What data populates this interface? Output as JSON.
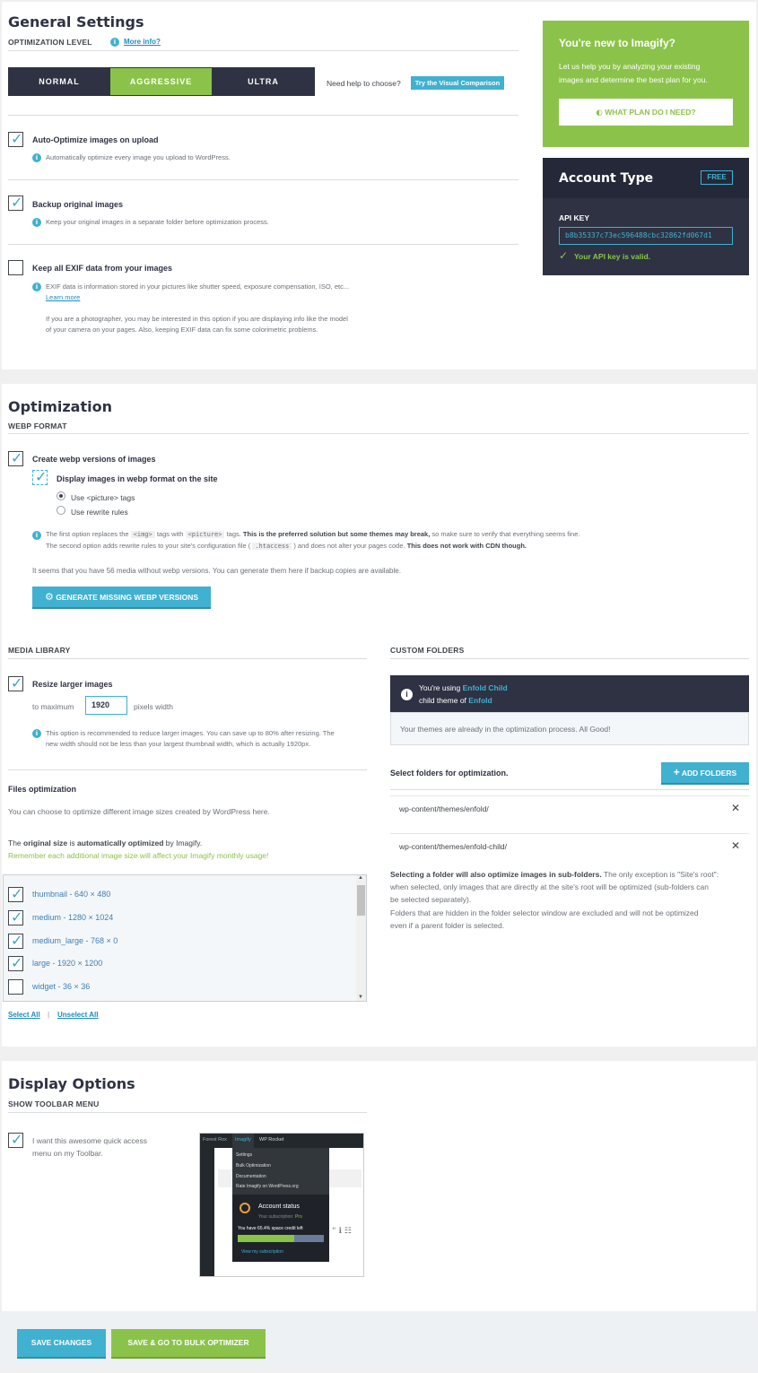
{
  "general": {
    "title": "General Settings",
    "opt_level_label": "OPTIMIZATION LEVEL",
    "more_info": "More info?",
    "levels": [
      "NORMAL",
      "AGGRESSIVE",
      "ULTRA"
    ],
    "selected_level": "AGGRESSIVE",
    "help_text": "Need help to choose?",
    "visual_comparison": "Try the Visual Comparison",
    "auto_optimize_label": "Auto-Optimize images on upload",
    "auto_optimize_desc": "Automatically optimize every image you upload to WordPress.",
    "backup_label": "Backup original images",
    "backup_desc": "Keep your original images in a separate folder before optimization process.",
    "exif_label": "Keep all EXIF data from your images",
    "exif_desc": "EXIF data is information stored in your pictures like shutter speed, exposure compensation, ISO, etc...",
    "learn_more": "Learn more",
    "exif_note_1": "If you are a photographer, you may be interested in this option if you are displaying info like the model",
    "exif_note_2": "of your camera on your pages. Also, keeping EXIF data can fix some colorimetric problems."
  },
  "new_box": {
    "title": "You're new to Imagify?",
    "text_1": "Let us help you by analyzing your existing",
    "text_2": "images and determine the best plan for you.",
    "button": "WHAT PLAN DO I NEED?"
  },
  "account": {
    "title": "Account Type",
    "badge": "FREE",
    "api_label": "API KEY",
    "api_key": "b8b35337c73ec596488cbc32862fd067d1",
    "valid": "Your API key is valid."
  },
  "optimization": {
    "title": "Optimization",
    "webp_label": "WEBP FORMAT",
    "create_webp": "Create webp versions of images",
    "display_webp": "Display images in webp format on the site",
    "radio_picture": "Use <picture> tags",
    "radio_rewrite": "Use rewrite rules",
    "info_1a": "The first option replaces the",
    "code_img": "<img>",
    "info_1b": "tags with",
    "code_picture": "<picture>",
    "info_1c": "tags.",
    "info_1d": "This is the preferred solution but some themes may break,",
    "info_1e": "so make sure to verify that everything seems fine.",
    "info_2a": "The second option adds rewrite rules to your site's configuration file (",
    "code_htaccess": ".htaccess",
    "info_2b": ") and does not alter your pages code.",
    "info_2c": "This does not work with CDN though.",
    "media_note": "It seems that you have 56 media without webp versions. You can generate them here if backup copies are available.",
    "generate_button": "GENERATE MISSING WEBP VERSIONS"
  },
  "media_library": {
    "title": "MEDIA LIBRARY",
    "resize_label": "Resize larger images",
    "to_max": "to maximum",
    "max_width": "1920",
    "pixels_width": "pixels width",
    "resize_desc_1": "This option is recommended to reduce larger images. You can save up to 80% after resizing. The",
    "resize_desc_2": "new width should not be less than your largest thumbnail width, which is actually 1920px.",
    "files_title": "Files optimization",
    "files_desc": "You can choose to optimize different image sizes created by WordPress here.",
    "original_a": "The",
    "original_b": "original size",
    "original_c": "is",
    "original_d": "automatically optimized",
    "original_e": "by Imagify.",
    "remember": "Remember each additional image size will affect your Imagify monthly usage!",
    "sizes": [
      {
        "label": "thumbnail - 640 × 480",
        "checked": true
      },
      {
        "label": "medium - 1280 × 1024",
        "checked": true
      },
      {
        "label": "medium_large - 768 × 0",
        "checked": true
      },
      {
        "label": "large - 1920 × 1200",
        "checked": true
      },
      {
        "label": "widget - 36 × 36",
        "checked": false
      }
    ],
    "select_all": "Select All",
    "unselect_all": "Unselect All"
  },
  "custom_folders": {
    "title": "CUSTOM FOLDERS",
    "using": "You're using",
    "theme": "Enfold Child",
    "child_of": "child theme of",
    "parent": "Enfold",
    "good": "Your themes are already in the optimization process. All Good!",
    "select_label": "Select folders for optimization.",
    "add_button": "ADD FOLDERS",
    "folders": [
      "wp-content/themes/enfold/",
      "wp-content/themes/enfold-child/"
    ],
    "note_bold": "Selecting a folder will also optimize images in sub-folders.",
    "note_1": "The only exception is \"Site's root\":",
    "note_2": "when selected, only images that are directly at the site's root will be optimized (sub-folders can",
    "note_3": "be selected separately).",
    "note_4": "Folders that are hidden in the folder selector window are excluded and will not be optimized",
    "note_5": "even if a parent folder is selected."
  },
  "display": {
    "title": "Display Options",
    "toolbar_label": "SHOW TOOLBAR MENU",
    "toolbar_text_1": "I want this awesome quick access",
    "toolbar_text_2": "menu on my Toolbar.",
    "preview": {
      "bar_items": [
        "Forest Rox",
        "Imagify",
        "WP Rocket"
      ],
      "menu_items": [
        "Settings",
        "Bulk Optimization",
        "Documentation",
        "Rate Imagify on WordPress.org"
      ],
      "status_title": "Account status",
      "subscription_label": "Your subscription:",
      "subscription": "Pro",
      "credit": "You have 65.4% space credit left",
      "credit_fraction": 0.654,
      "view": "View my subscription"
    }
  },
  "footer": {
    "save": "SAVE CHANGES",
    "save_bulk": "SAVE & GO TO BULK OPTIMIZER"
  },
  "colors": {
    "accent": "#40b1d0",
    "green": "#8bc34a",
    "dark": "#2e3243"
  }
}
